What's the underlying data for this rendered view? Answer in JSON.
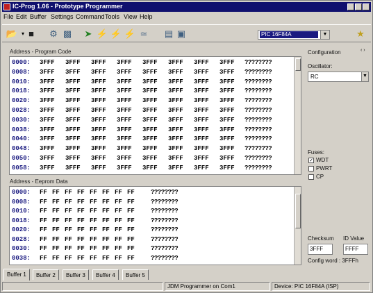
{
  "window": {
    "title": "IC-Prog 1.06 - Prototype Programmer"
  },
  "menu": [
    "File",
    "Edit",
    "Buffer",
    "Settings",
    "Command",
    "Tools",
    "View",
    "Help"
  ],
  "toolbar": {
    "device": "PIC 16F84A"
  },
  "program_code": {
    "caption": "Address - Program Code",
    "rows": [
      {
        "addr": "0000:",
        "cells": [
          "3FFF",
          "3FFF",
          "3FFF",
          "3FFF",
          "3FFF",
          "3FFF",
          "3FFF",
          "3FFF"
        ],
        "ascii": "????????"
      },
      {
        "addr": "0008:",
        "cells": [
          "3FFF",
          "3FFF",
          "3FFF",
          "3FFF",
          "3FFF",
          "3FFF",
          "3FFF",
          "3FFF"
        ],
        "ascii": "????????"
      },
      {
        "addr": "0010:",
        "cells": [
          "3FFF",
          "3FFF",
          "3FFF",
          "3FFF",
          "3FFF",
          "3FFF",
          "3FFF",
          "3FFF"
        ],
        "ascii": "????????"
      },
      {
        "addr": "0018:",
        "cells": [
          "3FFF",
          "3FFF",
          "3FFF",
          "3FFF",
          "3FFF",
          "3FFF",
          "3FFF",
          "3FFF"
        ],
        "ascii": "????????"
      },
      {
        "addr": "0020:",
        "cells": [
          "3FFF",
          "3FFF",
          "3FFF",
          "3FFF",
          "3FFF",
          "3FFF",
          "3FFF",
          "3FFF"
        ],
        "ascii": "????????"
      },
      {
        "addr": "0028:",
        "cells": [
          "3FFF",
          "3FFF",
          "3FFF",
          "3FFF",
          "3FFF",
          "3FFF",
          "3FFF",
          "3FFF"
        ],
        "ascii": "????????"
      },
      {
        "addr": "0030:",
        "cells": [
          "3FFF",
          "3FFF",
          "3FFF",
          "3FFF",
          "3FFF",
          "3FFF",
          "3FFF",
          "3FFF"
        ],
        "ascii": "????????"
      },
      {
        "addr": "0038:",
        "cells": [
          "3FFF",
          "3FFF",
          "3FFF",
          "3FFF",
          "3FFF",
          "3FFF",
          "3FFF",
          "3FFF"
        ],
        "ascii": "????????"
      },
      {
        "addr": "0040:",
        "cells": [
          "3FFF",
          "3FFF",
          "3FFF",
          "3FFF",
          "3FFF",
          "3FFF",
          "3FFF",
          "3FFF"
        ],
        "ascii": "????????"
      },
      {
        "addr": "0048:",
        "cells": [
          "3FFF",
          "3FFF",
          "3FFF",
          "3FFF",
          "3FFF",
          "3FFF",
          "3FFF",
          "3FFF"
        ],
        "ascii": "????????"
      },
      {
        "addr": "0050:",
        "cells": [
          "3FFF",
          "3FFF",
          "3FFF",
          "3FFF",
          "3FFF",
          "3FFF",
          "3FFF",
          "3FFF"
        ],
        "ascii": "????????"
      },
      {
        "addr": "0058:",
        "cells": [
          "3FFF",
          "3FFF",
          "3FFF",
          "3FFF",
          "3FFF",
          "3FFF",
          "3FFF",
          "3FFF"
        ],
        "ascii": "????????"
      }
    ]
  },
  "eeprom": {
    "caption": "Address - Eeprom Data",
    "rows": [
      {
        "addr": "0000:",
        "cells": [
          "FF",
          "FF",
          "FF",
          "FF",
          "FF",
          "FF",
          "FF",
          "FF"
        ],
        "ascii": "????????"
      },
      {
        "addr": "0008:",
        "cells": [
          "FF",
          "FF",
          "FF",
          "FF",
          "FF",
          "FF",
          "FF",
          "FF"
        ],
        "ascii": "????????"
      },
      {
        "addr": "0010:",
        "cells": [
          "FF",
          "FF",
          "FF",
          "FF",
          "FF",
          "FF",
          "FF",
          "FF"
        ],
        "ascii": "????????"
      },
      {
        "addr": "0018:",
        "cells": [
          "FF",
          "FF",
          "FF",
          "FF",
          "FF",
          "FF",
          "FF",
          "FF"
        ],
        "ascii": "????????"
      },
      {
        "addr": "0020:",
        "cells": [
          "FF",
          "FF",
          "FF",
          "FF",
          "FF",
          "FF",
          "FF",
          "FF"
        ],
        "ascii": "????????"
      },
      {
        "addr": "0028:",
        "cells": [
          "FF",
          "FF",
          "FF",
          "FF",
          "FF",
          "FF",
          "FF",
          "FF"
        ],
        "ascii": "????????"
      },
      {
        "addr": "0030:",
        "cells": [
          "FF",
          "FF",
          "FF",
          "FF",
          "FF",
          "FF",
          "FF",
          "FF"
        ],
        "ascii": "????????"
      },
      {
        "addr": "0038:",
        "cells": [
          "FF",
          "FF",
          "FF",
          "FF",
          "FF",
          "FF",
          "FF",
          "FF"
        ],
        "ascii": "????????"
      }
    ]
  },
  "config": {
    "title": "Configuration",
    "oscillator_label": "Oscillator:",
    "oscillator_value": "RC",
    "fuses_label": "Fuses:",
    "fuses": [
      {
        "label": "WDT",
        "checked": true
      },
      {
        "label": "PWRT",
        "checked": false
      },
      {
        "label": "CP",
        "checked": false
      }
    ],
    "checksum_label": "Checksum",
    "checksum_value": "3FFF",
    "id_label": "ID Value",
    "id_value": "FFFF",
    "config_word": "Config word : 3FFFh"
  },
  "tabs": [
    "Buffer 1",
    "Buffer 2",
    "Buffer 3",
    "Buffer 4",
    "Buffer 5"
  ],
  "status": {
    "programmer": "JDM Programmer on Com1",
    "device": "Device: PIC 16F84A  (ISP)"
  },
  "colors": {
    "titlebar": "#10106e",
    "address": "#1a1a80",
    "face": "#d4d0c8"
  }
}
